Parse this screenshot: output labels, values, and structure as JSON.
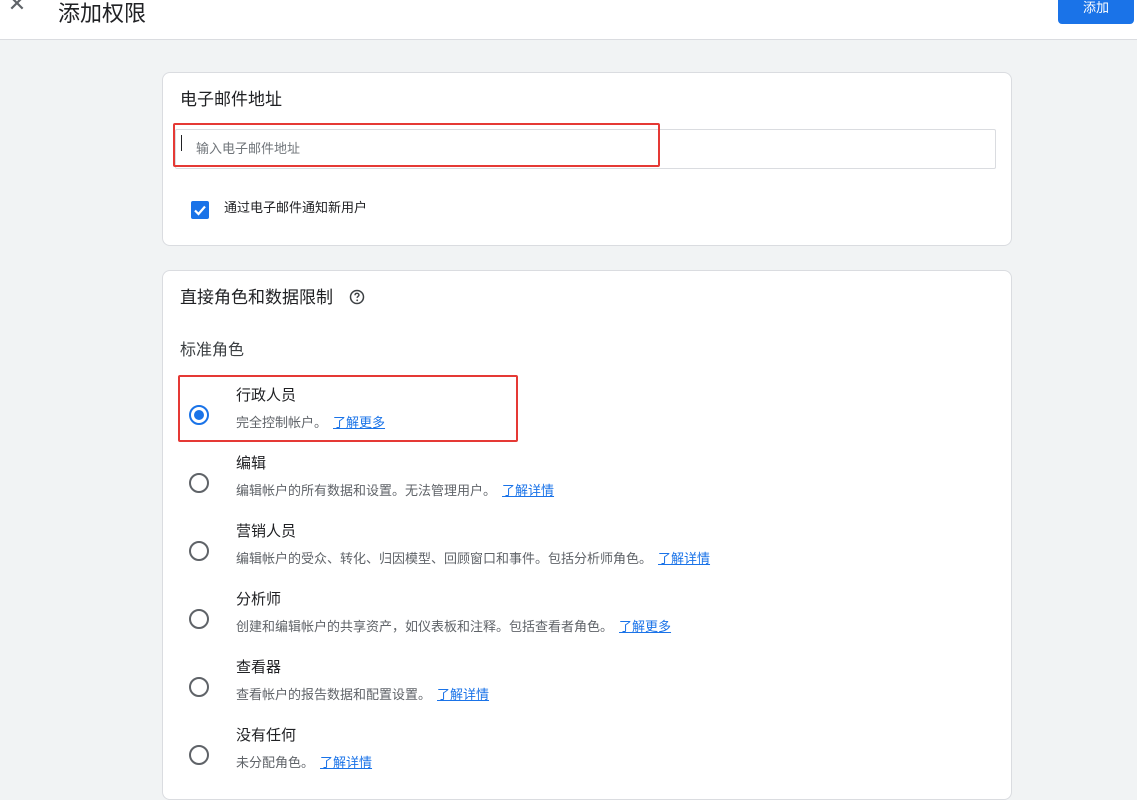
{
  "header": {
    "title": "添加权限",
    "close_icon": "close-icon",
    "add_label": "添加"
  },
  "email_section": {
    "title": "电子邮件地址",
    "placeholder": "输入电子邮件地址",
    "value": "",
    "notify_checked": true,
    "notify_label": "通过电子邮件通知新用户"
  },
  "roles_section": {
    "title": "直接角色和数据限制",
    "help_icon": "help-circle-icon",
    "standard_roles_label": "标准角色",
    "roles": [
      {
        "name": "行政人员",
        "desc": "完全控制帐户。",
        "link": "了解更多",
        "selected": true
      },
      {
        "name": "编辑",
        "desc": "编辑帐户的所有数据和设置。无法管理用户。",
        "link": "了解详情",
        "selected": false
      },
      {
        "name": "营销人员",
        "desc": "编辑帐户的受众、转化、归因模型、回顾窗口和事件。包括分析师角色。",
        "link": "了解详情",
        "selected": false
      },
      {
        "name": "分析师",
        "desc": "创建和编辑帐户的共享资产，如仪表板和注释。包括查看者角色。",
        "link": "了解更多",
        "selected": false
      },
      {
        "name": "查看器",
        "desc": "查看帐户的报告数据和配置设置。",
        "link": "了解详情",
        "selected": false
      },
      {
        "name": "没有任何",
        "desc": "未分配角色。",
        "link": "了解详情",
        "selected": false
      }
    ]
  },
  "colors": {
    "accent": "#1a73e8",
    "highlight_box": "#e53935"
  }
}
